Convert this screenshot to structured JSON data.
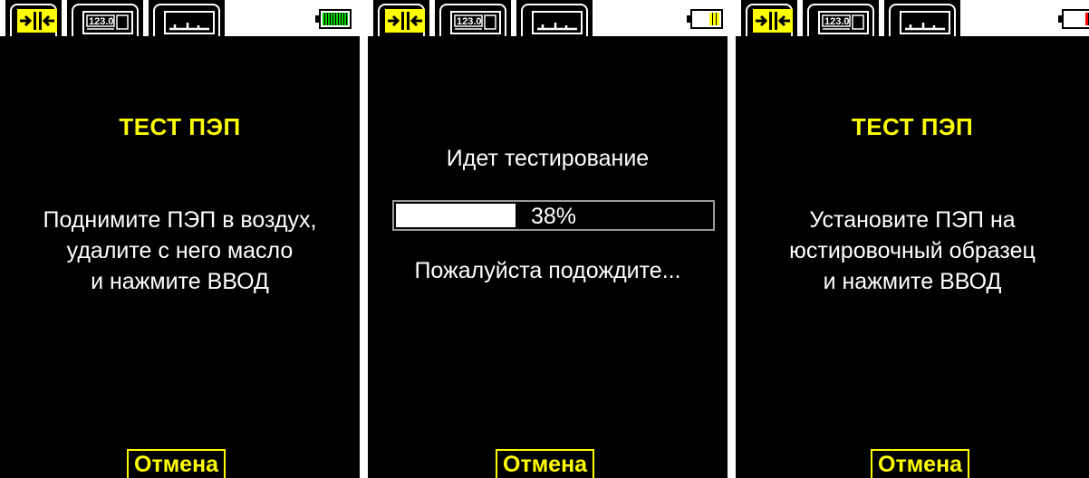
{
  "screens": [
    {
      "title": "ТЕСТ ПЭП",
      "lines": [
        "Поднимите ПЭП в воздух,",
        "удалите с него масло",
        "и нажмите ВВОД"
      ],
      "cancel_label": "Отмена",
      "battery": {
        "level": 1.0,
        "color": "#00cc00"
      }
    },
    {
      "status_text": "Идет тестирование",
      "progress": {
        "value": 0.38,
        "label": "38%"
      },
      "wait_text": "Пожалуйста подождите...",
      "cancel_label": "Отмена",
      "battery": {
        "level": 0.4,
        "color": "#ffff00"
      }
    },
    {
      "title": "ТЕСТ ПЭП",
      "lines": [
        "Установите ПЭП на",
        "юстировочный образец",
        "и нажмите ВВОД"
      ],
      "cancel_label": "Отмена",
      "battery": {
        "level": 0.2,
        "color": "#ff0000"
      }
    }
  ],
  "tabs": [
    "a-scan-tab",
    "digital-tab",
    "graph-tab"
  ],
  "accent_color": "#ffff00"
}
